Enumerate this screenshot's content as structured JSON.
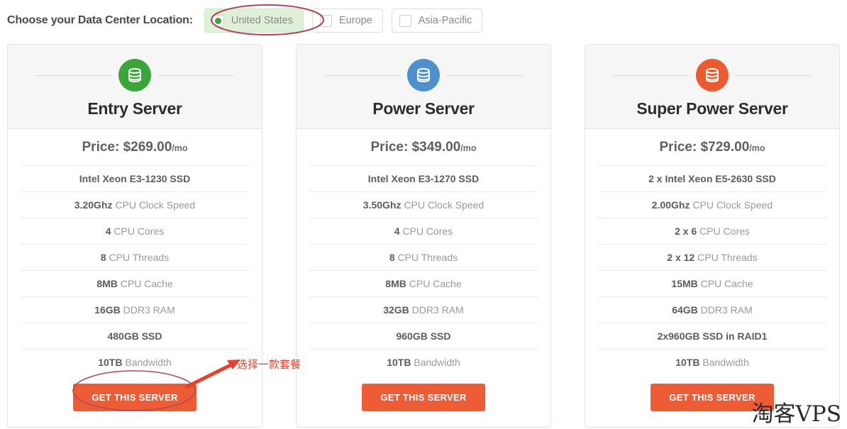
{
  "location_selector": {
    "title": "Choose your Data Center Location:",
    "options": [
      {
        "label": "United States",
        "selected": true,
        "icon": "radio-filled-icon"
      },
      {
        "label": "Europe",
        "selected": false,
        "icon": "radio-empty-icon"
      },
      {
        "label": "Asia-Pacific",
        "selected": false,
        "icon": "radio-empty-icon"
      }
    ]
  },
  "plans": [
    {
      "name": "Entry Server",
      "icon": "database-stack-icon",
      "icon_color": "#3aa63a",
      "price_label": "Price: $269.00",
      "price_period": "/mo",
      "specs": [
        {
          "value": "Intel Xeon E3-1230 SSD",
          "label": "",
          "all_bold": true
        },
        {
          "value": "3.20Ghz",
          "label": " CPU Clock Speed",
          "all_bold": false
        },
        {
          "value": "4",
          "label": " CPU Cores",
          "all_bold": false
        },
        {
          "value": "8",
          "label": " CPU Threads",
          "all_bold": false
        },
        {
          "value": "8MB",
          "label": " CPU Cache",
          "all_bold": false
        },
        {
          "value": "16GB",
          "label": " DDR3 RAM",
          "all_bold": false
        },
        {
          "value": "480GB SSD",
          "label": "",
          "all_bold": true
        },
        {
          "value": "10TB",
          "label": " Bandwidth",
          "all_bold": false
        }
      ],
      "cta_label": "GET THIS SERVER"
    },
    {
      "name": "Power Server",
      "icon": "database-stack-icon",
      "icon_color": "#4e90cd",
      "price_label": "Price: $349.00",
      "price_period": "/mo",
      "specs": [
        {
          "value": "Intel Xeon E3-1270 SSD",
          "label": "",
          "all_bold": true
        },
        {
          "value": "3.50Ghz",
          "label": " CPU Clock Speed",
          "all_bold": false
        },
        {
          "value": "4",
          "label": " CPU Cores",
          "all_bold": false
        },
        {
          "value": "8",
          "label": " CPU Threads",
          "all_bold": false
        },
        {
          "value": "8MB",
          "label": " CPU Cache",
          "all_bold": false
        },
        {
          "value": "32GB",
          "label": " DDR3 RAM",
          "all_bold": false
        },
        {
          "value": "960GB SSD",
          "label": "",
          "all_bold": true
        },
        {
          "value": "10TB",
          "label": " Bandwidth",
          "all_bold": false
        }
      ],
      "cta_label": "GET THIS SERVER"
    },
    {
      "name": "Super Power Server",
      "icon": "database-stack-icon",
      "icon_color": "#ec5b30",
      "price_label": "Price: $729.00",
      "price_period": "/mo",
      "specs": [
        {
          "value": "2 x Intel Xeon E5-2630 SSD",
          "label": "",
          "all_bold": true
        },
        {
          "value": "2.00Ghz",
          "label": " CPU Clock Speed",
          "all_bold": false
        },
        {
          "value": "2 x 6",
          "label": " CPU Cores",
          "all_bold": false
        },
        {
          "value": "2 x 12",
          "label": " CPU Threads",
          "all_bold": false
        },
        {
          "value": "15MB",
          "label": " CPU Cache",
          "all_bold": false
        },
        {
          "value": "64GB",
          "label": " DDR3 RAM",
          "all_bold": false
        },
        {
          "value": "2x960GB SSD in RAID1",
          "label": "",
          "all_bold": true
        },
        {
          "value": "10TB",
          "label": " Bandwidth",
          "all_bold": false
        }
      ],
      "cta_label": "GET THIS SERVER"
    }
  ],
  "annotations": {
    "arrow_note": "选择一款套餐",
    "ink_color": "#e8402a",
    "ellipse_color": "#b0485a"
  },
  "watermark": {
    "text": "淘客VPS"
  }
}
